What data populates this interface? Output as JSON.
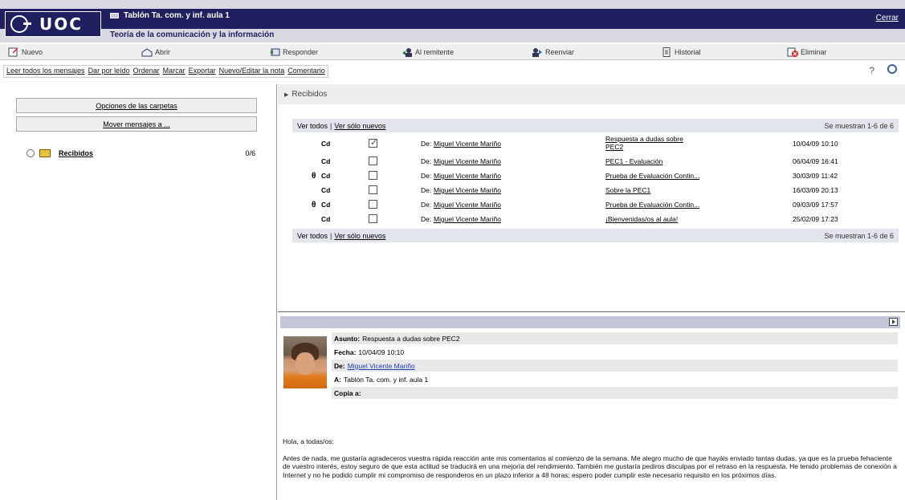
{
  "header": {
    "logo": "UOC",
    "title": "Tablón Ta. com. y inf. aula 1",
    "subtitle": "Teoría de la comunicación y la información",
    "close_label": "Cerrar"
  },
  "toolbar": [
    {
      "label": "Nuevo",
      "icon": "new-message-icon"
    },
    {
      "label": "Abrir",
      "icon": "open-icon"
    },
    {
      "label": "Responder",
      "icon": "reply-icon"
    },
    {
      "label": "Al remitente",
      "icon": "reply-sender-icon"
    },
    {
      "label": "Reenviar",
      "icon": "forward-icon"
    },
    {
      "label": "Historial",
      "icon": "history-icon"
    },
    {
      "label": "Eliminar",
      "icon": "delete-icon"
    }
  ],
  "actions": [
    "Leer todos los mensajes",
    "Dar por leído",
    "Ordenar",
    "Marcar",
    "Exportar",
    "Nuevo/Editar la nota",
    "Comentario"
  ],
  "left": {
    "folder_options": "Opciones de las carpetas",
    "move_messages": "Mover mensajes a ...",
    "folder_name": "Recibidos",
    "folder_count": "0/6"
  },
  "inbox": {
    "title": "Recibidos",
    "view_all": "Ver todos",
    "separator": "|",
    "view_new": "Ver sólo nuevos",
    "showing": "Se muestran 1-6 de 6"
  },
  "messages": [
    {
      "attachment": "",
      "cd": "Cd",
      "checked": true,
      "from_label": "De:",
      "from": "Miguel Vicente Mariño",
      "subject": "Respuesta a dudas sobre",
      "subject2": "PEC2",
      "date": "10/04/09 10:10"
    },
    {
      "attachment": "",
      "cd": "Cd",
      "checked": false,
      "from_label": "De:",
      "from": "Miguel Vicente Mariño",
      "subject": "PEC1 - Evaluación",
      "subject2": "",
      "date": "06/04/09 16:41"
    },
    {
      "attachment": "θ",
      "cd": "Cd",
      "checked": false,
      "from_label": "De:",
      "from": "Miguel Vicente Mariño",
      "subject": "Prueba de Evaluación Contin...",
      "subject2": "",
      "date": "30/03/09 11:42"
    },
    {
      "attachment": "",
      "cd": "Cd",
      "checked": false,
      "from_label": "De:",
      "from": "Miguel Vicente Mariño",
      "subject": "Sobre la PEC1",
      "subject2": "",
      "date": "16/03/09 20:13"
    },
    {
      "attachment": "θ",
      "cd": "Cd",
      "checked": false,
      "from_label": "De:",
      "from": "Miguel Vicente Mariño",
      "subject": "Prueba de Evaluación Contin...",
      "subject2": "",
      "date": "09/03/09 17:57"
    },
    {
      "attachment": "",
      "cd": "Cd",
      "checked": false,
      "from_label": "De:",
      "from": "Miguel Vicente Mariño",
      "subject": "¡Bienvenidas/os al aula!",
      "subject2": "",
      "date": "25/02/09 17:23"
    }
  ],
  "preview": {
    "subject_label": "Asunto:",
    "subject": "Respuesta a dudas sobre PEC2",
    "date_label": "Fecha:",
    "date": "10/04/09 10:10",
    "from_label": "De:",
    "from": "Miguel Vicente Mariño",
    "to_label": "A:",
    "to": "Tablón Ta. com. y inf. aula 1",
    "cc_label": "Copia a:",
    "greeting": "Hola, a todas/os:",
    "body": "Antes de nada, me gustaría agradeceros vuestra rápida reacción ante mis comentarios al comienzo de la semana. Me alegro mucho de que hayáis enviado tantas dudas, ya que es la prueba fehaciente de vuestro interés,  estoy seguro de que esta actitud se traducirá en una mejoría del rendimiento. También me gustaría pediros disculpas por el retraso en la respuesta. He tenido problemas de conexión a Internet y no he podido cumplir mi compromiso de responderos en un plazo inferior a 48 horas; espero poder cumplir este necesario requisito en los próximos días."
  }
}
